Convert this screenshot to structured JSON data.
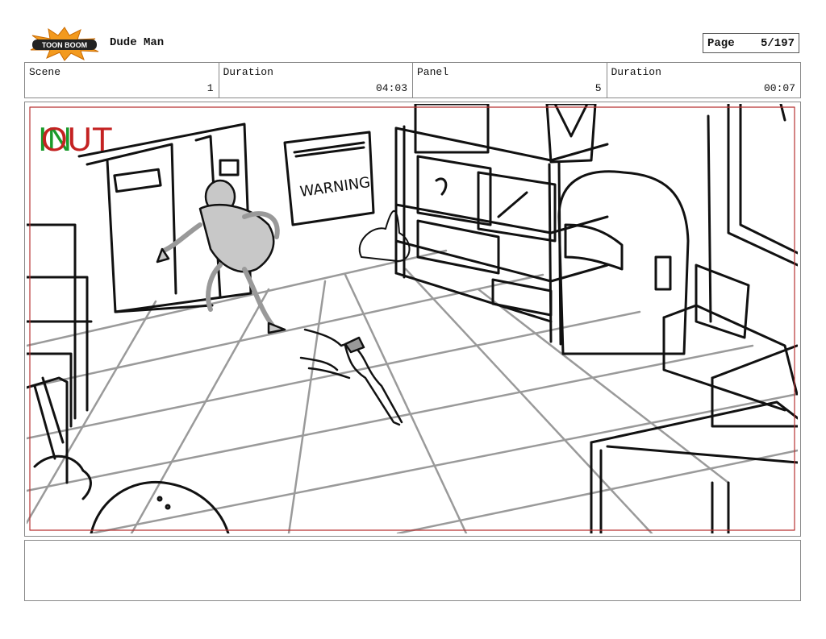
{
  "header": {
    "logo_text": "TOON BOOM",
    "project_title": "Dude Man",
    "page_label": "Page",
    "page_value": "5/197"
  },
  "info": {
    "scene_label": "Scene",
    "scene_value": "1",
    "scene_duration_label": "Duration",
    "scene_duration_value": "04:03",
    "panel_label": "Panel",
    "panel_value": "5",
    "panel_duration_label": "Duration",
    "panel_duration_value": "00:07"
  },
  "panel": {
    "in_mark": "IN",
    "out_mark": "OUT",
    "sign_text": "WARNING"
  },
  "colors": {
    "in_green": "#1a9a2a",
    "out_red": "#c42222",
    "safe_frame": "#b83232",
    "sketch_line": "#111111",
    "grid_line": "#9a9a9a",
    "character_fill": "#c8c8c8"
  }
}
